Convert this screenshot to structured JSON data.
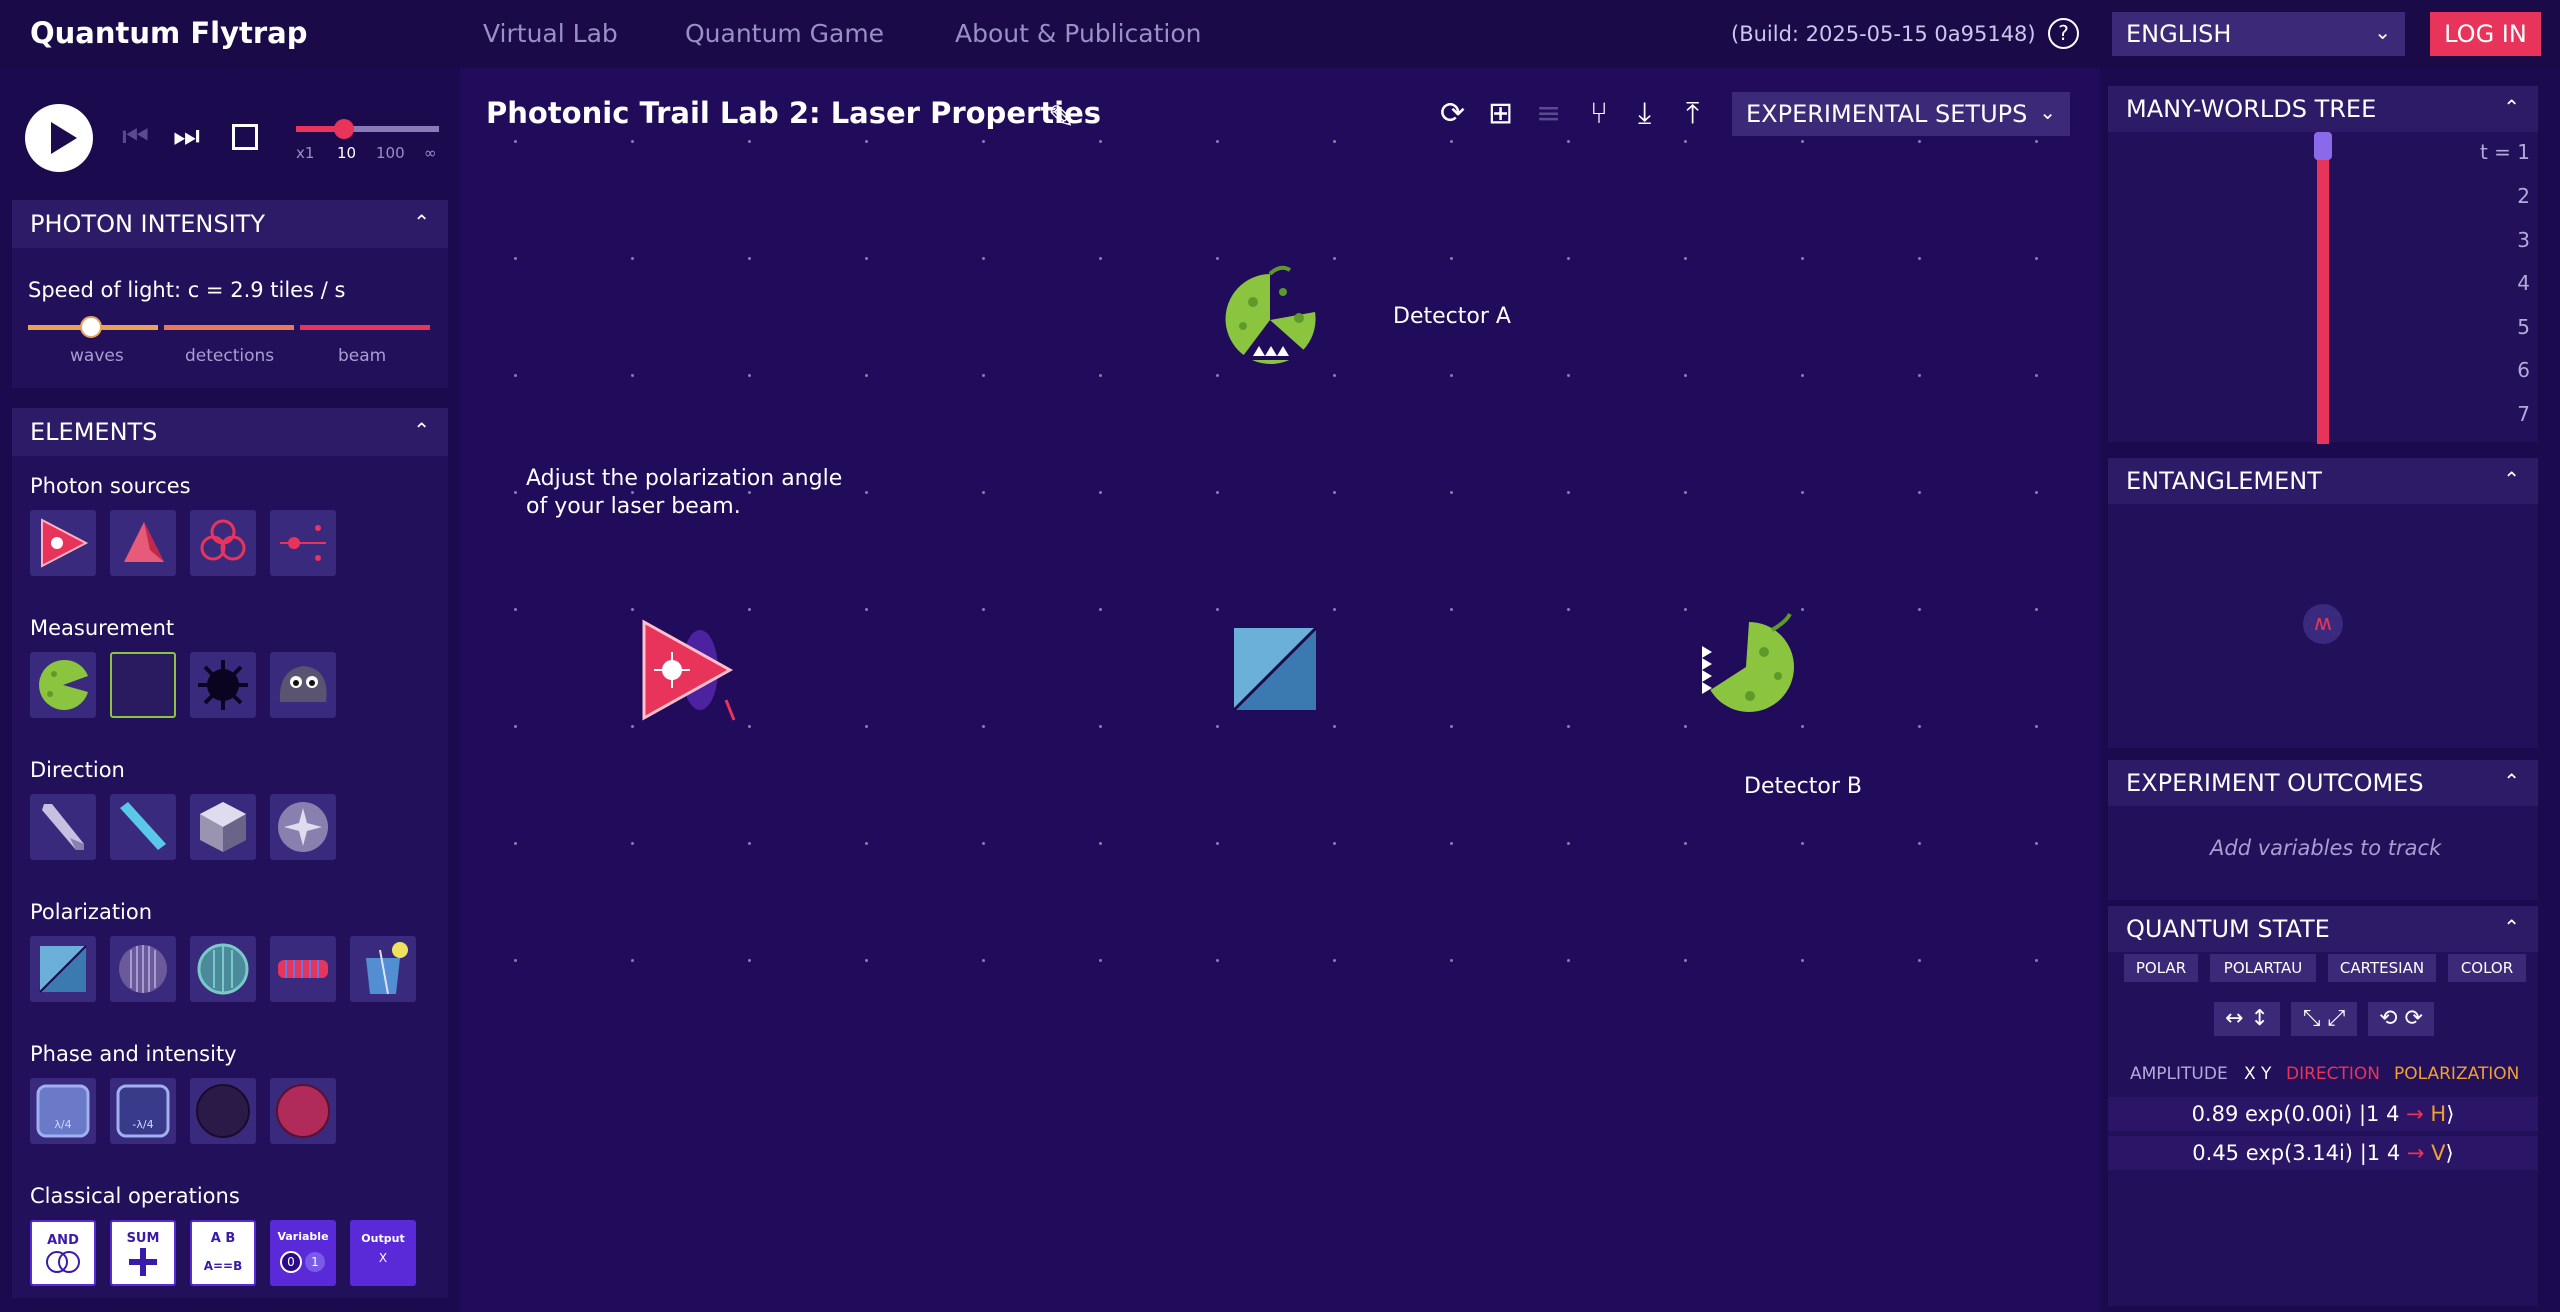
{
  "app": {
    "brand": "Quantum Flytrap",
    "nav": [
      "Virtual Lab",
      "Quantum Game",
      "About & Publication"
    ],
    "build": "(Build: 2025-05-15 0a95148)",
    "help": "?",
    "language": "ENGLISH",
    "login": "LOG IN"
  },
  "controls": {
    "speed_ticks": [
      "x1",
      "10",
      "100",
      "∞"
    ],
    "speed_selected": "10"
  },
  "photon_intensity": {
    "title": "PHOTON INTENSITY",
    "speed_label": "Speed of light: c = 2.9 tiles / s",
    "ticks": [
      "waves",
      "detections",
      "beam"
    ]
  },
  "elements": {
    "title": "ELEMENTS",
    "categories": [
      {
        "name": "Photon sources",
        "tiles": [
          "laser-icon",
          "single-photon-source-icon",
          "ghz-source-icon",
          "pair-source-icon"
        ]
      },
      {
        "name": "Measurement",
        "tiles": [
          "detector-icon",
          "detector-box-icon",
          "mine-icon",
          "rock-icon"
        ]
      },
      {
        "name": "Direction",
        "tiles": [
          "mirror-icon",
          "beam-splitter-icon",
          "corner-cube-icon",
          "faraday-icon"
        ]
      },
      {
        "name": "Polarization",
        "tiles": [
          "polarizing-beam-splitter-icon",
          "polarizer-icon",
          "wave-plate-icon",
          "faraday-rotator-icon",
          "sugar-solution-icon"
        ]
      },
      {
        "name": "Phase and intensity",
        "tiles": [
          "phase-plate-icon",
          "phase-plate-minus-icon",
          "absorber-icon",
          "filter-icon"
        ]
      },
      {
        "name": "Classical operations",
        "tiles": [
          "and-gate-icon",
          "sum-gate-icon",
          "comparator-icon",
          "variable-icon",
          "output-icon"
        ]
      }
    ],
    "classical_labels": {
      "and": "AND",
      "sum": "SUM",
      "compare_top": "A B",
      "compare_bottom": "A==B",
      "variable": "Variable",
      "var_0": "0",
      "var_1": "1",
      "output": "Output",
      "output_x": "X"
    },
    "plate_labels": {
      "quarter": "λ/4",
      "minus_quarter": "-λ/4"
    }
  },
  "lab": {
    "title": "Photonic Trail Lab 2: Laser Properties",
    "experimental_setups": "EXPERIMENTAL SETUPS",
    "toolbar_icons": [
      "refresh-icon",
      "new-file-icon",
      "add-list-icon",
      "branch-icon",
      "download-icon",
      "upload-icon"
    ],
    "labels": {
      "detector_a": "Detector A",
      "detector_b": "Detector B",
      "hint_line1": "Adjust the polarization angle",
      "hint_line2": "of your laser beam."
    }
  },
  "many_worlds": {
    "title": "MANY-WORLDS TREE",
    "time_labels": [
      "t = 1",
      "2",
      "3",
      "4",
      "5",
      "6",
      "7"
    ]
  },
  "entanglement": {
    "title": "ENTANGLEMENT",
    "icon_glyph": "ʍ"
  },
  "outcomes": {
    "title": "EXPERIMENT OUTCOMES",
    "placeholder": "Add variables to track"
  },
  "quantum_state": {
    "title": "QUANTUM STATE",
    "formats": [
      "POLAR",
      "POLARTAU",
      "CARTESIAN",
      "COLOR"
    ],
    "ops": [
      "↔ ↕",
      "⤡ ⤢",
      "⟲ ⟳"
    ],
    "columns": [
      "AMPLITUDE",
      "X Y",
      "DIRECTION",
      "POLARIZATION"
    ],
    "rows": [
      {
        "amplitude": "0.89 exp(0.00i)",
        "pos": "|1 4",
        "dir": " → ",
        "pol": "H",
        "close": "⟩"
      },
      {
        "amplitude": "0.45 exp(3.14i)",
        "pos": "|1 4",
        "dir": " → ",
        "pol": "V",
        "close": "⟩"
      }
    ]
  },
  "colors": {
    "background": "#210b5b",
    "accent": "#e8345a",
    "detector_green": "#8bc53f",
    "direction": "#e8345a",
    "polarization": "#f0a030"
  }
}
